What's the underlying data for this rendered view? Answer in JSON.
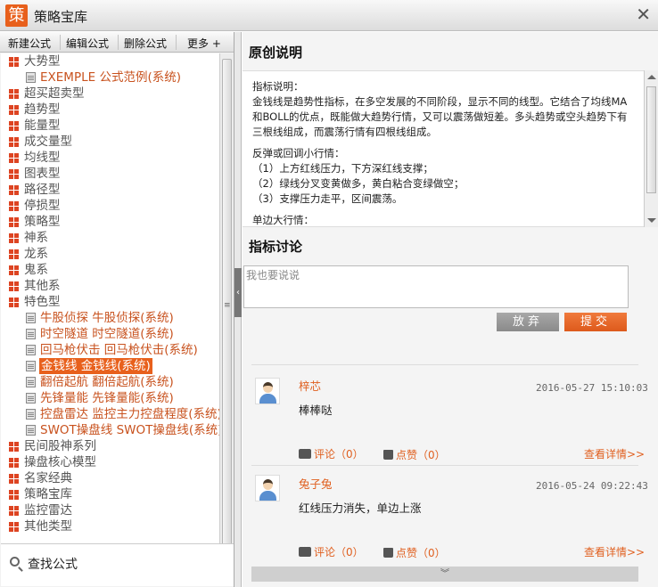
{
  "window": {
    "title": "策略宝库",
    "logo_text": "策",
    "close_glyph": "✕"
  },
  "toolbar": {
    "new_formula": "新建公式",
    "edit_formula": "编辑公式",
    "delete_formula": "删除公式",
    "more": "更多 +"
  },
  "tree": {
    "items": [
      {
        "type": "cat",
        "label": "大势型"
      },
      {
        "type": "leaf",
        "label": "EXEMPLE  公式范例(系统)"
      },
      {
        "type": "cat",
        "label": "超买超卖型"
      },
      {
        "type": "cat",
        "label": "趋势型"
      },
      {
        "type": "cat",
        "label": "能量型"
      },
      {
        "type": "cat",
        "label": "成交量型"
      },
      {
        "type": "cat",
        "label": "均线型"
      },
      {
        "type": "cat",
        "label": "图表型"
      },
      {
        "type": "cat",
        "label": "路径型"
      },
      {
        "type": "cat",
        "label": "停损型"
      },
      {
        "type": "cat",
        "label": "策略型"
      },
      {
        "type": "cat",
        "label": "神系"
      },
      {
        "type": "cat",
        "label": "龙系"
      },
      {
        "type": "cat",
        "label": "鬼系"
      },
      {
        "type": "cat",
        "label": "其他系"
      },
      {
        "type": "cat",
        "label": "特色型"
      },
      {
        "type": "leaf",
        "label": "牛股侦探  牛股侦探(系统)"
      },
      {
        "type": "leaf",
        "label": "时空隧道  时空隧道(系统)"
      },
      {
        "type": "leaf",
        "label": "回马枪伏击  回马枪伏击(系统)"
      },
      {
        "type": "leaf",
        "label": "金钱线  金钱线(系统)",
        "selected": true
      },
      {
        "type": "leaf",
        "label": "翻倍起航  翻倍起航(系统)"
      },
      {
        "type": "leaf",
        "label": "先锋量能  先锋量能(系统)"
      },
      {
        "type": "leaf",
        "label": "控盘雷达  监控主力控盘程度(系统)"
      },
      {
        "type": "leaf",
        "label": "SWOT操盘线  SWOT操盘线(系统)"
      },
      {
        "type": "cat",
        "label": "民间股神系列"
      },
      {
        "type": "cat",
        "label": "操盘核心模型"
      },
      {
        "type": "cat",
        "label": "名家经典"
      },
      {
        "type": "cat",
        "label": "策略宝库"
      },
      {
        "type": "cat",
        "label": "监控雷达"
      },
      {
        "type": "cat",
        "label": "其他类型"
      }
    ]
  },
  "search": {
    "label": "查找公式"
  },
  "original": {
    "heading": "原创说明",
    "lines": [
      "指标说明：",
      "金钱线是趋势性指标，在多空发展的不同阶段，显示不同的线型。它结合了均线MA和BOLL的优点，既能做大趋势行情，又可以震荡做短差。多头趋势或空头趋势下有三根线组成，而震荡行情有四根线组成。",
      "反弹或回调小行情：",
      "（1）上方红线压力，下方深红线支撑；",
      "（2）绿线分叉变黄做多，黄白粘合变绿做空；",
      "（3）支撑压力走平，区间震荡。",
      "单边大行情："
    ]
  },
  "discussion": {
    "heading": "指标讨论",
    "input_placeholder": "我也要说说",
    "cancel_label": "放弃",
    "submit_label": "提交",
    "comments": [
      {
        "user": "梓芯",
        "date": "2016-05-27 15:10:03",
        "text": "棒棒哒",
        "comment_label": "评论（0）",
        "like_label": "点赞（0）",
        "detail_label": "查看详情>>"
      },
      {
        "user": "兔子兔",
        "date": "2016-05-24 09:22:43",
        "text": "红线压力消失，单边上涨",
        "comment_label": "评论（0）",
        "like_label": "点赞（0）",
        "detail_label": "查看详情>>"
      }
    ],
    "more_glyph": "︾"
  },
  "colors": {
    "accent": "#e8601c",
    "link": "#e06020",
    "tree_icon": "#dd4422"
  }
}
